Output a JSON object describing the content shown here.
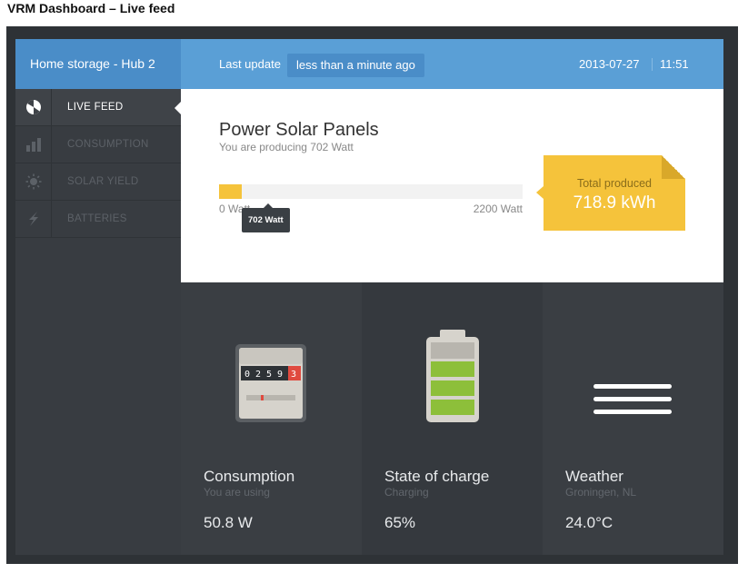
{
  "caption": "VRM Dashboard – Live feed",
  "sidebar": {
    "title": "Home storage - Hub 2",
    "items": [
      {
        "label": "LIVE FEED",
        "icon": "pie-chart-icon",
        "active": true
      },
      {
        "label": "CONSUMPTION",
        "icon": "bar-chart-icon",
        "active": false
      },
      {
        "label": "SOLAR YIELD",
        "icon": "sun-icon",
        "active": false
      },
      {
        "label": "BATTERIES",
        "icon": "lightning-icon",
        "active": false
      }
    ]
  },
  "topbar": {
    "last_update_label": "Last update",
    "last_update_value": "less than a minute ago",
    "date": "2013-07-27",
    "time": "11:51"
  },
  "solar": {
    "title": "Power Solar Panels",
    "subtitle": "You are producing 702 Watt",
    "min_label": "0 Watt",
    "max_label": "2200 Watt",
    "min_watt": 0,
    "max_watt": 2200,
    "current_watt": 702,
    "tooltip": "702 Watt",
    "total_label": "Total produced",
    "total_value": "718.9 kWh",
    "accent": "#f5c33b"
  },
  "tiles": [
    {
      "title": "Consumption",
      "subtitle": "You are using",
      "value": "50.8 W",
      "icon": "electric-meter-icon",
      "meter_digits": [
        "0",
        "2",
        "5",
        "9",
        "3"
      ]
    },
    {
      "title": "State of charge",
      "subtitle": "Charging",
      "value": "65%",
      "icon": "battery-icon",
      "charge_fraction": 0.65
    },
    {
      "title": "Weather",
      "subtitle": "Groningen, NL",
      "value": "24.0°C",
      "icon": "fog-icon"
    }
  ],
  "colors": {
    "topbar": "#5a9fd6",
    "sidebar_header": "#4a8dc8",
    "sidebar": "#383c41",
    "tiles": "#3a3e43",
    "battery_cell": "#8dbf3a"
  }
}
